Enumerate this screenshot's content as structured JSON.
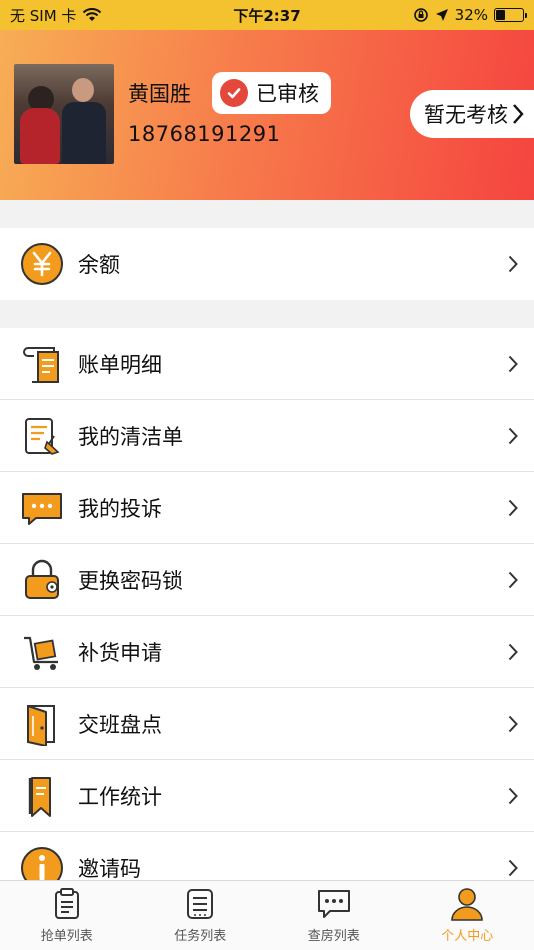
{
  "status_bar": {
    "carrier": "无 SIM 卡",
    "time": "下午2:37",
    "battery": "32%",
    "battery_level": 0.32
  },
  "profile": {
    "name": "黄国胜",
    "verified_label": "已审核",
    "phone": "18768191291",
    "exam_button": "暂无考核"
  },
  "balance_section": {
    "label": "余额",
    "icon": "yuan-icon"
  },
  "menu_items": [
    {
      "label": "账单明细",
      "icon": "bill-scroll-icon"
    },
    {
      "label": "我的清洁单",
      "icon": "cleaning-list-icon"
    },
    {
      "label": "我的投诉",
      "icon": "complaint-chat-icon"
    },
    {
      "label": "更换密码锁",
      "icon": "lock-icon"
    },
    {
      "label": "补货申请",
      "icon": "cart-restock-icon"
    },
    {
      "label": "交班盘点",
      "icon": "door-shift-icon"
    },
    {
      "label": "工作统计",
      "icon": "bookmark-stats-icon"
    },
    {
      "label": "邀请码",
      "icon": "info-icon"
    }
  ],
  "tab_bar": [
    {
      "label": "抢单列表",
      "icon": "clipboard-icon",
      "active": false
    },
    {
      "label": "任务列表",
      "icon": "task-list-icon",
      "active": false
    },
    {
      "label": "查房列表",
      "icon": "chat-bubble-icon",
      "active": false
    },
    {
      "label": "个人中心",
      "icon": "person-icon",
      "active": true
    }
  ],
  "colors": {
    "accent": "#f39b1c",
    "status_bar": "#f5c22f",
    "header_gradient_start": "#f7ae55",
    "header_gradient_end": "#f5443f",
    "verified_red": "#e4483b"
  }
}
